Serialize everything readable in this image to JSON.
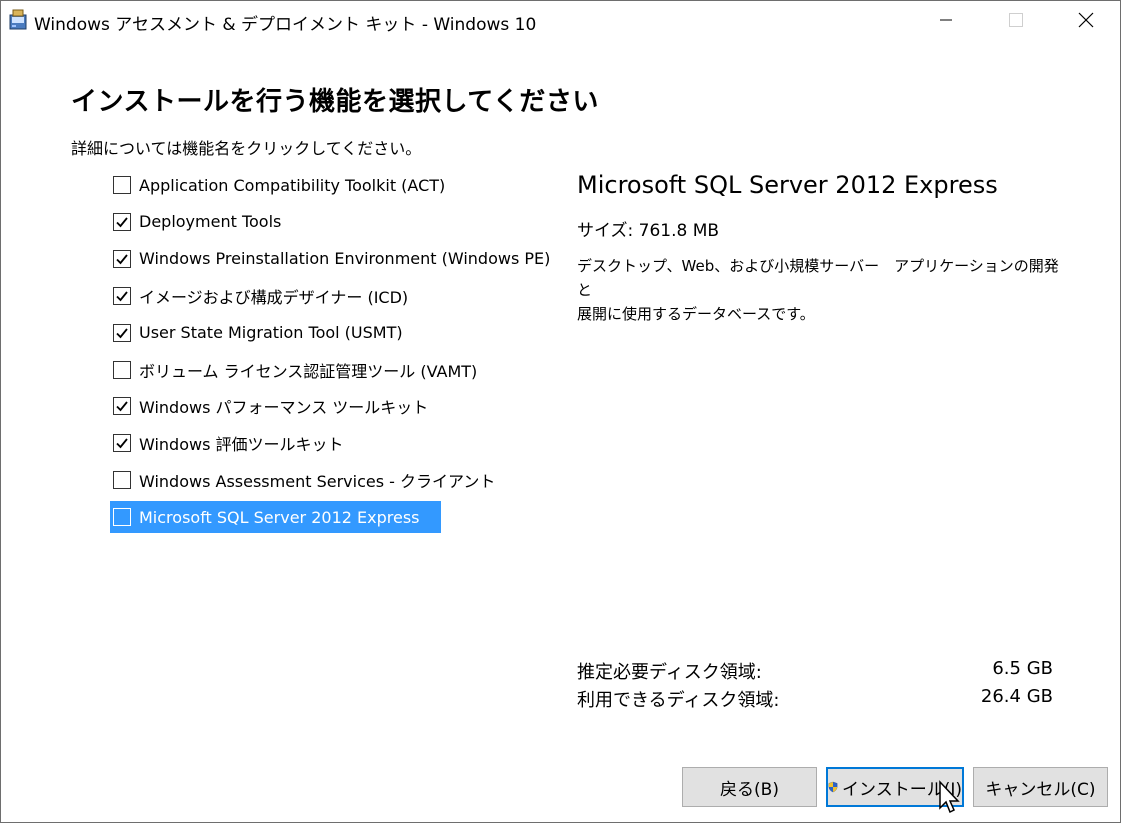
{
  "window": {
    "title": "Windows アセスメント & デプロイメント キット - Windows 10"
  },
  "header": {
    "title": "インストールを行う機能を選択してください",
    "subtitle": "詳細については機能名をクリックしてください。"
  },
  "features": [
    {
      "label": "Application Compatibility Toolkit (ACT)",
      "checked": false,
      "selected": false
    },
    {
      "label": "Deployment Tools",
      "checked": true,
      "selected": false
    },
    {
      "label": "Windows Preinstallation Environment (Windows PE)",
      "checked": true,
      "selected": false
    },
    {
      "label": "イメージおよび構成デザイナー (ICD)",
      "checked": true,
      "selected": false
    },
    {
      "label": "User State Migration Tool (USMT)",
      "checked": true,
      "selected": false
    },
    {
      "label": "ボリューム ライセンス認証管理ツール (VAMT)",
      "checked": false,
      "selected": false
    },
    {
      "label": "Windows パフォーマンス ツールキット",
      "checked": true,
      "selected": false
    },
    {
      "label": "Windows 評価ツールキット",
      "checked": true,
      "selected": false
    },
    {
      "label": "Windows Assessment Services - クライアント",
      "checked": false,
      "selected": false
    },
    {
      "label": "Microsoft SQL Server 2012 Express",
      "checked": false,
      "selected": true
    }
  ],
  "details": {
    "title": "Microsoft SQL Server 2012 Express",
    "size_label": "サイズ:",
    "size_value": "761.8 MB",
    "description_line1": "デスクトップ、Web、および小規模サーバー　アプリケーションの開発と",
    "description_line2": "展開に使用するデータベースです。"
  },
  "disk": {
    "required_label": "推定必要ディスク領域:",
    "required_value": "6.5 GB",
    "available_label": "利用できるディスク領域:",
    "available_value": "26.4 GB"
  },
  "buttons": {
    "back": "戻る(B)",
    "install": "インストール(I)",
    "cancel": "キャンセル(C)"
  },
  "colors": {
    "selection": "#3399ff",
    "button_face": "#e1e1e1",
    "default_button_border": "#0078d7"
  },
  "icons": {
    "app": "installer-package-icon",
    "install": "uac-shield-icon"
  }
}
